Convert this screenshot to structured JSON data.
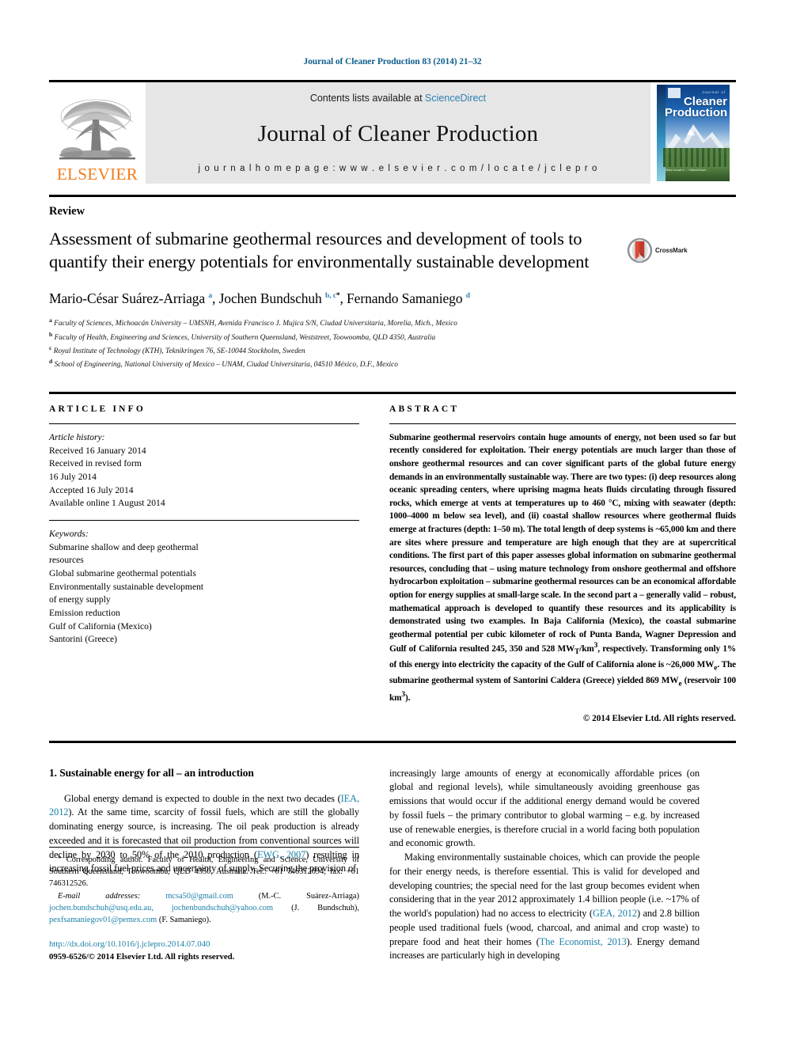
{
  "running_head": "Journal of Cleaner Production 83 (2014) 21–32",
  "masthead": {
    "publisher_name": "ELSEVIER",
    "contents_prefix": "Contents lists available at",
    "sciencedirect": "ScienceDirect",
    "journal_name": "Journal of Cleaner Production",
    "homepage": "j o u r n a l   h o m e p a g e :   w w w . e l s e v i e r . c o m / l o c a t e / j c l e p r o",
    "cover": {
      "kicker": "Journal of",
      "title_line1": "Cleaner",
      "title_line2": "Production",
      "footer_text": "Official Journal of ... • Editorial Board ..."
    }
  },
  "article": {
    "doctype": "Review",
    "title": "Assessment of submarine geothermal resources and development of tools to quantify their energy potentials for environmentally sustainable development",
    "crossmark_label": "CrossMark",
    "authors_html": "Mario-César Suárez-Arriaga <sup>a</sup>, Jochen Bundschuh <sup>b, c</sup><sup class=\"star\">*</sup>, Fernando Samaniego <sup>d</sup>",
    "affiliations": [
      {
        "marker": "a",
        "text": "Faculty of Sciences, Michoacán University – UMSNH, Avenida Francisco J. Mujica S/N, Ciudad Universitaria, Morelia, Mich., Mexico"
      },
      {
        "marker": "b",
        "text": "Faculty of Health, Engineering and Sciences, University of Southern Queensland, Weststreet, Toowoomba, QLD 4350, Australia"
      },
      {
        "marker": "c",
        "text": "Royal Institute of Technology (KTH), Teknikringen 76, SE-10044 Stockholm, Sweden"
      },
      {
        "marker": "d",
        "text": "School of Engineering, National University of Mexico – UNAM, Ciudad Universitaria, 04510 México, D.F., Mexico"
      }
    ]
  },
  "article_info": {
    "label": "ARTICLE INFO",
    "history_label": "Article history:",
    "history": [
      "Received 16 January 2014",
      "Received in revised form",
      "16 July 2014",
      "Accepted 16 July 2014",
      "Available online 1 August 2014"
    ],
    "keywords_label": "Keywords:",
    "keywords": [
      "Submarine shallow and deep geothermal",
      "resources",
      "Global submarine geothermal potentials",
      "Environmentally sustainable development",
      "of energy supply",
      "Emission reduction",
      "Gulf of California (Mexico)",
      "Santorini (Greece)"
    ]
  },
  "abstract": {
    "label": "ABSTRACT",
    "text": "Submarine geothermal reservoirs contain huge amounts of energy, not been used so far but recently considered for exploitation. Their energy potentials are much larger than those of onshore geothermal resources and can cover significant parts of the global future energy demands in an environmentally sustainable way. There are two types: (i) deep resources along oceanic spreading centers, where uprising magma heats fluids circulating through fissured rocks, which emerge at vents at temperatures up to 460 °C, mixing with seawater (depth: 1000–4000 m below sea level), and (ii) coastal shallow resources where geothermal fluids emerge at fractures (depth: 1–50 m). The total length of deep systems is ~65,000 km and there are sites where pressure and temperature are high enough that they are at supercritical conditions. The first part of this paper assesses global information on submarine geothermal resources, concluding that – using mature technology from onshore geothermal and offshore hydrocarbon exploitation – submarine geothermal resources can be an economical affordable option for energy supplies at small-large scale. In the second part a – generally valid – robust, mathematical approach is developed to quantify these resources and its applicability is demonstrated using two examples. In Baja California (Mexico), the coastal submarine geothermal potential per cubic kilometer of rock of Punta Banda, Wagner Depression and Gulf of California resulted 245, 350 and 528 MWT/km3, respectively. Transforming only 1% of this energy into electricity the capacity of the Gulf of California alone is ~26,000 MWe. The submarine geothermal system of Santorini Caldera (Greece) yielded 869 MWe (reservoir 100 km3).",
    "copyright": "© 2014 Elsevier Ltd. All rights reserved."
  },
  "body": {
    "section_heading": "1. Sustainable energy for all – an introduction",
    "left_paragraphs": [
      "Global energy demand is expected to double in the next two decades (IEA, 2012). At the same time, scarcity of fossil fuels, which are still the globally dominating energy source, is increasing. The oil peak production is already exceeded and it is forecasted that oil production from conventional sources will decline by 2030 to 50% of the 2010 production (EWG, 2007) resulting in increasing fossil fuel prices and uncertainty of supply. Securing the provision of"
    ],
    "right_paragraphs": [
      "increasingly large amounts of energy at economically affordable prices (on global and regional levels), while simultaneously avoiding greenhouse gas emissions that would occur if the additional energy demand would be covered by fossil fuels – the primary contributor to global warming – e.g. by increased use of renewable energies, is therefore crucial in a world facing both population and economic growth.",
      "Making environmentally sustainable choices, which can provide the people for their energy needs, is therefore essential. This is valid for developed and developing countries; the special need for the last group becomes evident when considering that in the year 2012 approximately 1.4 billion people (i.e. ~17% of the world's population) had no access to electricity (GEA, 2012) and 2.8 billion people used traditional fuels (wood, charcoal, and animal and crop waste) to prepare food and heat their homes (The Economist, 2013). Energy demand increases are particularly high in developing"
    ],
    "references_inline": [
      "IEA, 2012",
      "EWG, 2007",
      "GEA, 2012",
      "The Economist, 2013"
    ]
  },
  "footnotes": {
    "corresponding": "* Corresponding author. Faculty of Health, Engineering and Science, University of Southern Queensland, Toowoomba, QLD 4350, Australia. Tel.: +61 746312694; fax: +61 746312526.",
    "email_label": "E-mail addresses:",
    "emails": [
      {
        "address": "mcsa50@gmail.com",
        "owner": "(M.-C. Suárez-Arriaga)"
      },
      {
        "address": "jochen.bundschuh@usq.edu.au,",
        "owner": ""
      },
      {
        "address": "jochenbundschuh@yahoo.com",
        "owner": "(J. Bundschuh),"
      },
      {
        "address": "pexfsamaniegov01@pemex.com",
        "owner": "(F. Samaniego)."
      }
    ],
    "doi": "http://dx.doi.org/10.1016/j.jclepro.2014.07.040",
    "issn_line": "0959-6526/© 2014 Elsevier Ltd. All rights reserved."
  },
  "colors": {
    "link_blue": "#1a7fa8",
    "head_blue": "#12608f",
    "sciencedirect_blue": "#2f7fb5",
    "elsevier_orange": "#f07c1a",
    "masthead_grey": "#e6e6e6"
  }
}
